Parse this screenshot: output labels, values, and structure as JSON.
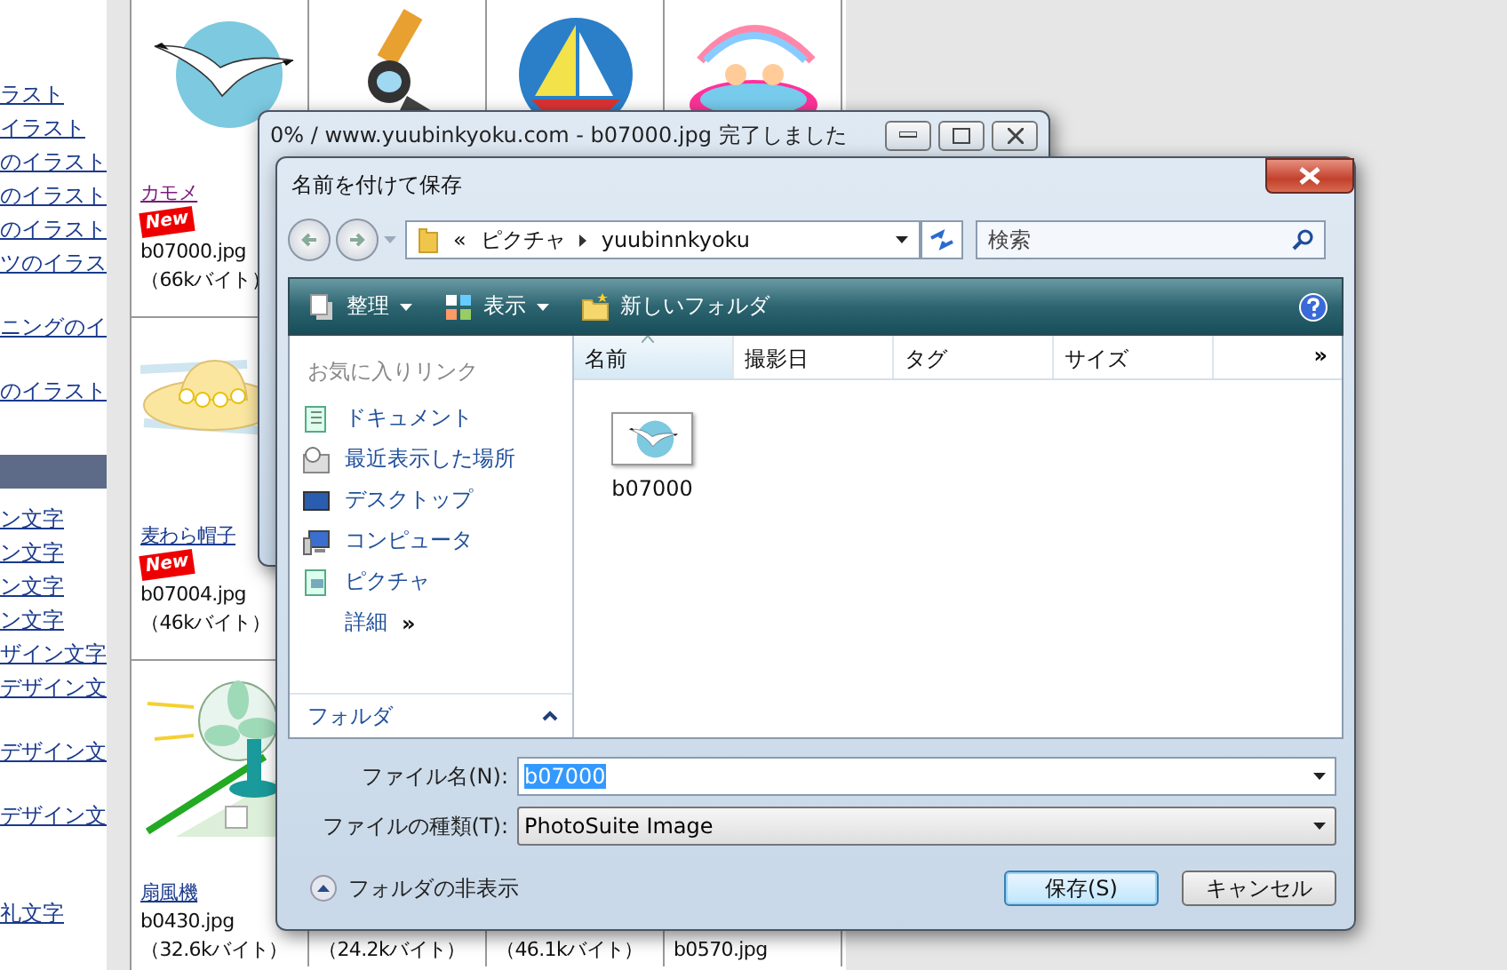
{
  "web_page": {
    "nav_links": [
      "ラスト",
      "イラスト",
      "のイラスト",
      "のイラスト",
      "のイラスト",
      "ツのイラス",
      "ニングのイ",
      "のイラスト",
      "ン文字",
      "ン文字",
      "ン文字",
      "ン文字",
      "ザイン文字",
      "デザイン文",
      "デザイン文",
      "デザイン文",
      "礼文字"
    ],
    "grid": [
      [
        {
          "kind": "seagull",
          "name": "カモメ",
          "visited": true,
          "badge": "New",
          "file": "b07000.jpg",
          "size": "（66kバイト）"
        },
        {
          "kind": "diver"
        },
        {
          "kind": "sailboat"
        },
        {
          "kind": "pool"
        }
      ],
      [
        {
          "kind": "hat",
          "name": "麦わら帽子",
          "visited": false,
          "badge": "New",
          "file": "b07004.jpg",
          "size": "（46kバイト）"
        }
      ],
      [
        {
          "kind": "fan",
          "name": "扇風機",
          "visited": false,
          "file": "b0430.jpg",
          "size": "（32.6kバイト）"
        },
        {
          "size": "（24.2kバイト）"
        },
        {
          "size": "（46.1kバイト）"
        },
        {
          "file": "b0570.jpg"
        }
      ]
    ]
  },
  "progress_window": {
    "title": "0% / www.yuubinkyoku.com - b07000.jpg 完了しました"
  },
  "save_dialog": {
    "title": "名前を付けて保存",
    "address": {
      "overflow": "«",
      "crumbs": [
        "ピクチャ",
        "yuubinnkyoku"
      ]
    },
    "search": {
      "placeholder": "検索"
    },
    "toolbar": [
      {
        "label": "整理",
        "kind": "organize",
        "menu": true
      },
      {
        "label": "表示",
        "kind": "views",
        "menu": true
      },
      {
        "label": "新しいフォルダ",
        "kind": "new_folder",
        "menu": false
      }
    ],
    "favorites": {
      "heading": "お気に入りリンク",
      "links": [
        {
          "label": "ドキュメント",
          "kind": "documents"
        },
        {
          "label": "最近表示した場所",
          "kind": "recent"
        },
        {
          "label": "デスクトップ",
          "kind": "desktop"
        },
        {
          "label": "コンピュータ",
          "kind": "computer"
        },
        {
          "label": "ピクチャ",
          "kind": "pictures"
        }
      ],
      "more": "詳細",
      "more_arrow": "»"
    },
    "folders": {
      "label": "フォルダ"
    },
    "columns": [
      {
        "label": "名前",
        "sorted": true
      },
      {
        "label": "撮影日",
        "sorted": false
      },
      {
        "label": "タグ",
        "sorted": false
      },
      {
        "label": "サイズ",
        "sorted": false
      }
    ],
    "more_columns": "»",
    "files": [
      {
        "name": "b07000",
        "kind": "seagull"
      }
    ],
    "file_name": {
      "label": "ファイル名(N):",
      "value": "b07000",
      "value_selected": true
    },
    "file_type": {
      "label": "ファイルの種類(T):",
      "value": "PhotoSuite Image"
    },
    "hide_folders": "フォルダの非表示",
    "buttons": [
      {
        "label": "保存(S)",
        "default": true
      },
      {
        "label": "キャンセル",
        "default": false
      }
    ]
  }
}
